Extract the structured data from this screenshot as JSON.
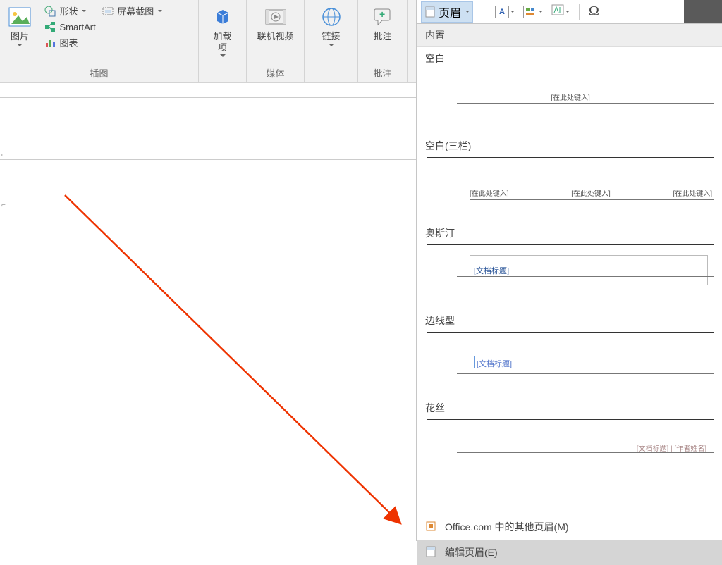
{
  "ribbon": {
    "insert": {
      "picture": "图片",
      "shapes": "形状",
      "smartart": "SmartArt",
      "screenshot": "屏幕截图",
      "chart": "图表",
      "group_label": "插图"
    },
    "addin": {
      "label_l1": "加载",
      "label_l2": "项"
    },
    "media": {
      "label": "联机视频",
      "group_label": "媒体"
    },
    "link": {
      "label": "链接",
      "group_label": ""
    },
    "comment": {
      "label": "批注",
      "group_label": "批注"
    }
  },
  "headerPanel": {
    "button_label": "页眉",
    "builtin": "内置",
    "items": {
      "blank": {
        "label": "空白",
        "ph": "[在此处键入]"
      },
      "blank3": {
        "label": "空白(三栏)",
        "ph1": "[在此处键入]",
        "ph2": "[在此处键入]",
        "ph3": "[在此处键入]"
      },
      "austin": {
        "label": "奥斯汀",
        "ph": "[文档标题]"
      },
      "sideline": {
        "label": "边线型",
        "ph": "[文档标题]"
      },
      "filigree": {
        "label": "花丝",
        "ph": "[文档标题] | [作者姓名]"
      }
    },
    "footer": {
      "office_more": "Office.com 中的其他页眉(M)",
      "edit_header": "编辑页眉(E)"
    },
    "textbox_letter": "A",
    "omega": "Ω"
  }
}
